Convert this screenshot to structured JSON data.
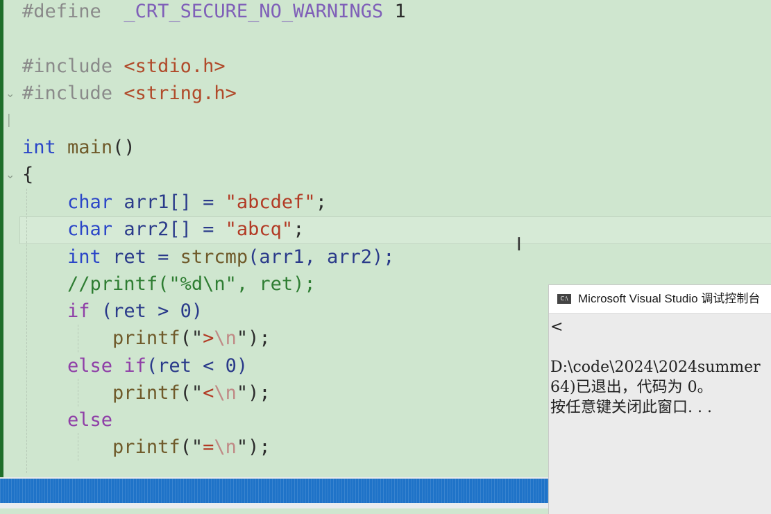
{
  "editor": {
    "lines": {
      "l1": {
        "directive": "#define",
        "macro": "_CRT_SECURE_NO_WARNINGS",
        "value": "1"
      },
      "l2": {
        "directive": "#include",
        "header": "<stdio.h>"
      },
      "l3": {
        "directive": "#include",
        "header": "<string.h>"
      },
      "l4": {
        "type": "int",
        "name": "main",
        "parens": "()"
      },
      "l5": {
        "brace": "{"
      },
      "l6": {
        "type": "char",
        "decl": "arr1[] = ",
        "str": "\"abcdef\"",
        "end": ";"
      },
      "l7": {
        "type": "char",
        "decl": "arr2[] = ",
        "str": "\"abcq\"",
        "end": ";"
      },
      "l8": {
        "type": "int",
        "decl": "ret = ",
        "fn": "strcmp",
        "args": "(arr1, arr2);"
      },
      "l9": {
        "comment": "//printf(\"%d\\n\", ret);"
      },
      "l10": {
        "kw": "if",
        "rest": "(ret > 0)"
      },
      "l11": {
        "fn": "printf",
        "open": "(\"",
        "text": ">",
        "esc": "\\n",
        "close": "\");"
      },
      "l12": {
        "kw1": "else",
        "kw2": "if",
        "rest": "(ret < 0)"
      },
      "l13": {
        "fn": "printf",
        "open": "(\"",
        "text": "<",
        "esc": "\\n",
        "close": "\");"
      },
      "l14": {
        "kw": "else"
      },
      "l15": {
        "fn": "printf",
        "open": "(\"",
        "text": "=",
        "esc": "\\n",
        "close": "\");"
      }
    },
    "folds": {
      "chevron": "⌄",
      "bracket": "│"
    }
  },
  "cursor": {
    "glyph": "I"
  },
  "console": {
    "icon_text": "C:\\",
    "title": "Microsoft Visual Studio 调试控制台",
    "caret": "<",
    "line1": "D:\\code\\2024\\2024summer",
    "line2": "64)已退出，代码为 0。",
    "line3": "按任意键关闭此窗口. . ."
  },
  "colors": {
    "editor_bg": "#cfe6cf",
    "keyword": "#2a45c8",
    "control": "#8f3fa7",
    "string": "#b23a24",
    "comment": "#2e7d32",
    "scrollbar": "#1f73c8"
  }
}
